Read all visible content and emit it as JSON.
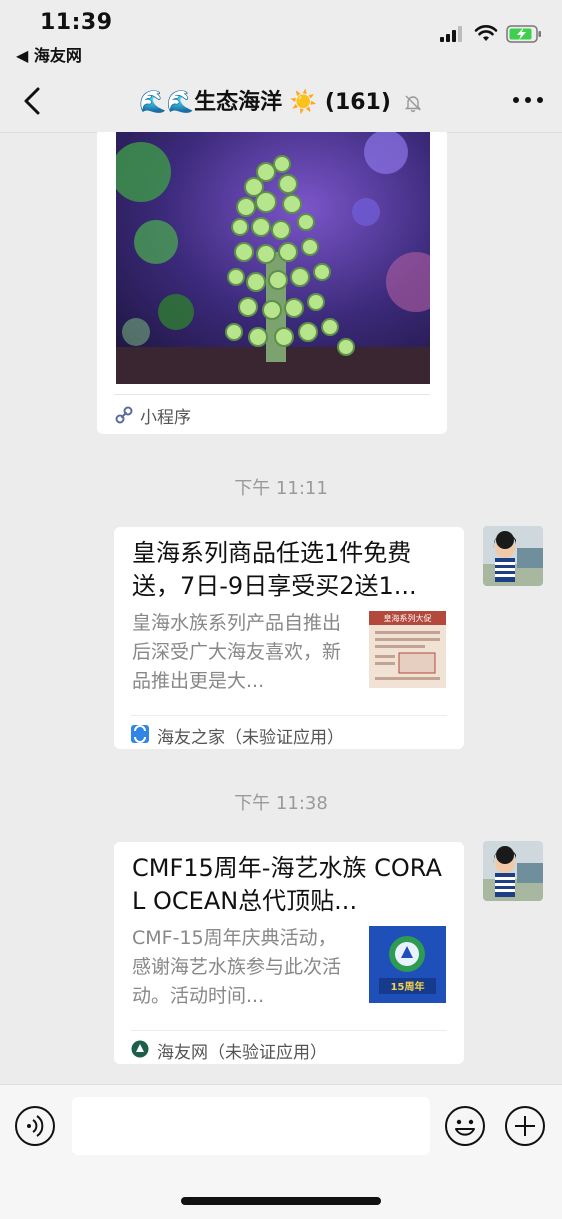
{
  "status_bar": {
    "time": "11:39",
    "back_app": "◀ 海友网"
  },
  "nav": {
    "title": "🌊🌊生态海洋 ☀️ (161)"
  },
  "chat": {
    "mini_program": {
      "label": "小程序"
    },
    "messages": [
      {
        "timestamp": "下午 11:11",
        "title": "皇海系列商品任选1件免费送，7日-9日享受买2送1...",
        "description": "皇海水族系列产品自推出后深受广大海友喜欢，新品推出更是大...",
        "thumb_text": "皇海系列大促",
        "source": "海友之家（未验证应用）"
      },
      {
        "timestamp": "下午 11:38",
        "title": "CMF15周年-海艺水族 CORAL OCEAN总代顶贴...",
        "description": "CMF-15周年庆典活动，感谢海艺水族参与此次活动。活动时间...",
        "thumb_text": "15周年",
        "source": "海友网（未验证应用）"
      }
    ]
  },
  "icons": {
    "signal": "signal-icon",
    "wifi": "wifi-icon",
    "battery": "battery-charging-icon",
    "back": "chevron-left-icon",
    "mute": "bell-slash-icon",
    "more": "more-dots-icon",
    "link": "link-icon",
    "voice": "voice-icon",
    "emoji": "smile-icon",
    "plus": "plus-icon"
  }
}
